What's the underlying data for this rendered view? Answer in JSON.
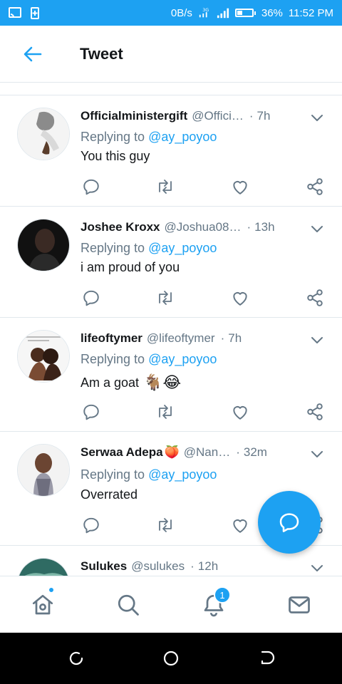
{
  "status_bar": {
    "data_rate": "0B/s",
    "network": "3G",
    "battery": "36%",
    "battery_level": 0.36,
    "time": "11:52 PM"
  },
  "header": {
    "title": "Tweet",
    "back_icon": "arrow-left-icon"
  },
  "tweets": [
    {
      "name": "Officialministergift",
      "handle": "@Offici…",
      "time": "7h",
      "replying_label": "Replying to",
      "mention": "@ay_poyoo",
      "text": "You this guy",
      "emoji": ""
    },
    {
      "name": "Joshee Kroxx",
      "handle": "@Joshua08…",
      "time": "13h",
      "replying_label": "Replying to",
      "mention": "@ay_poyoo",
      "text": "i am proud of you",
      "emoji": ""
    },
    {
      "name": "lifeoftymer",
      "handle": "@lifeoftymer",
      "time": "7h",
      "replying_label": "Replying to",
      "mention": "@ay_poyoo",
      "text": "Am a goat",
      "emoji": "🐐😂"
    },
    {
      "name": "Serwaa Adepa",
      "name_emoji": "🍑",
      "handle": "@Nan…",
      "time": "32m",
      "replying_label": "Replying to",
      "mention": "@ay_poyoo",
      "text": "Overrated",
      "emoji": ""
    },
    {
      "name": "Sulukes",
      "handle": "@sulukes",
      "time": "12h"
    }
  ],
  "bottom_nav": {
    "notification_count": "1"
  },
  "colors": {
    "accent": "#1da1f2",
    "text": "#14171a",
    "muted": "#657786",
    "divider": "#e1e8ed"
  }
}
